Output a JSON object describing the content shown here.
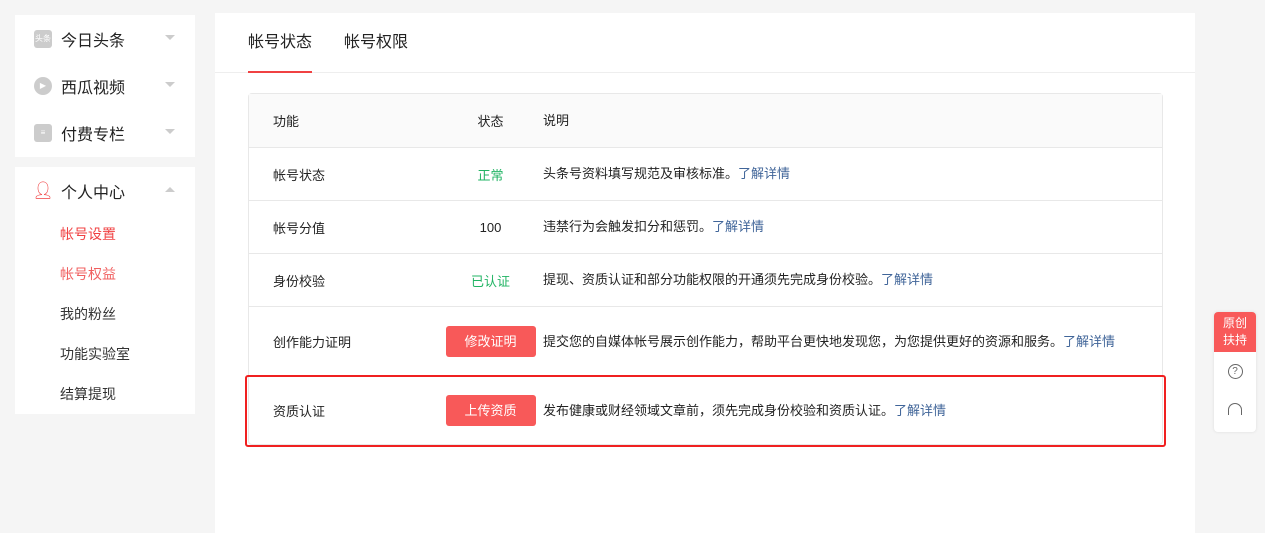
{
  "sidebar": {
    "groups": [
      {
        "label": "今日头条",
        "icon_text": "头条"
      },
      {
        "label": "西瓜视频"
      },
      {
        "label": "付费专栏"
      }
    ],
    "personal": {
      "label": "个人中心",
      "items": [
        "帐号设置",
        "帐号权益",
        "我的粉丝",
        "功能实验室",
        "结算提现"
      ]
    }
  },
  "tabs": [
    "帐号状态",
    "帐号权限"
  ],
  "table": {
    "headers": [
      "功能",
      "状态",
      "说明"
    ],
    "rows": [
      {
        "name": "帐号状态",
        "status": "正常",
        "desc": "头条号资料填写规范及审核标准。",
        "link": "了解详情"
      },
      {
        "name": "帐号分值",
        "status": "100",
        "desc": "违禁行为会触发扣分和惩罚。",
        "link": "了解详情"
      },
      {
        "name": "身份校验",
        "status": "已认证",
        "desc": "提现、资质认证和部分功能权限的开通须先完成身份校验。",
        "link": "了解详情"
      },
      {
        "name": "创作能力证明",
        "status": "修改证明",
        "desc": "提交您的自媒体帐号展示创作能力，帮助平台更快地发现您，为您提供更好的资源和服务。",
        "link": "了解详情"
      },
      {
        "name": "资质认证",
        "status": "上传资质",
        "desc": "发布健康或财经领域文章前，须先完成身份校验和资质认证。",
        "link": "了解详情"
      }
    ]
  },
  "float": {
    "badge": "原创扶持"
  },
  "colors": {
    "accent": "#f04142",
    "button": "#f85959",
    "green": "#22b464",
    "link": "#406599"
  }
}
